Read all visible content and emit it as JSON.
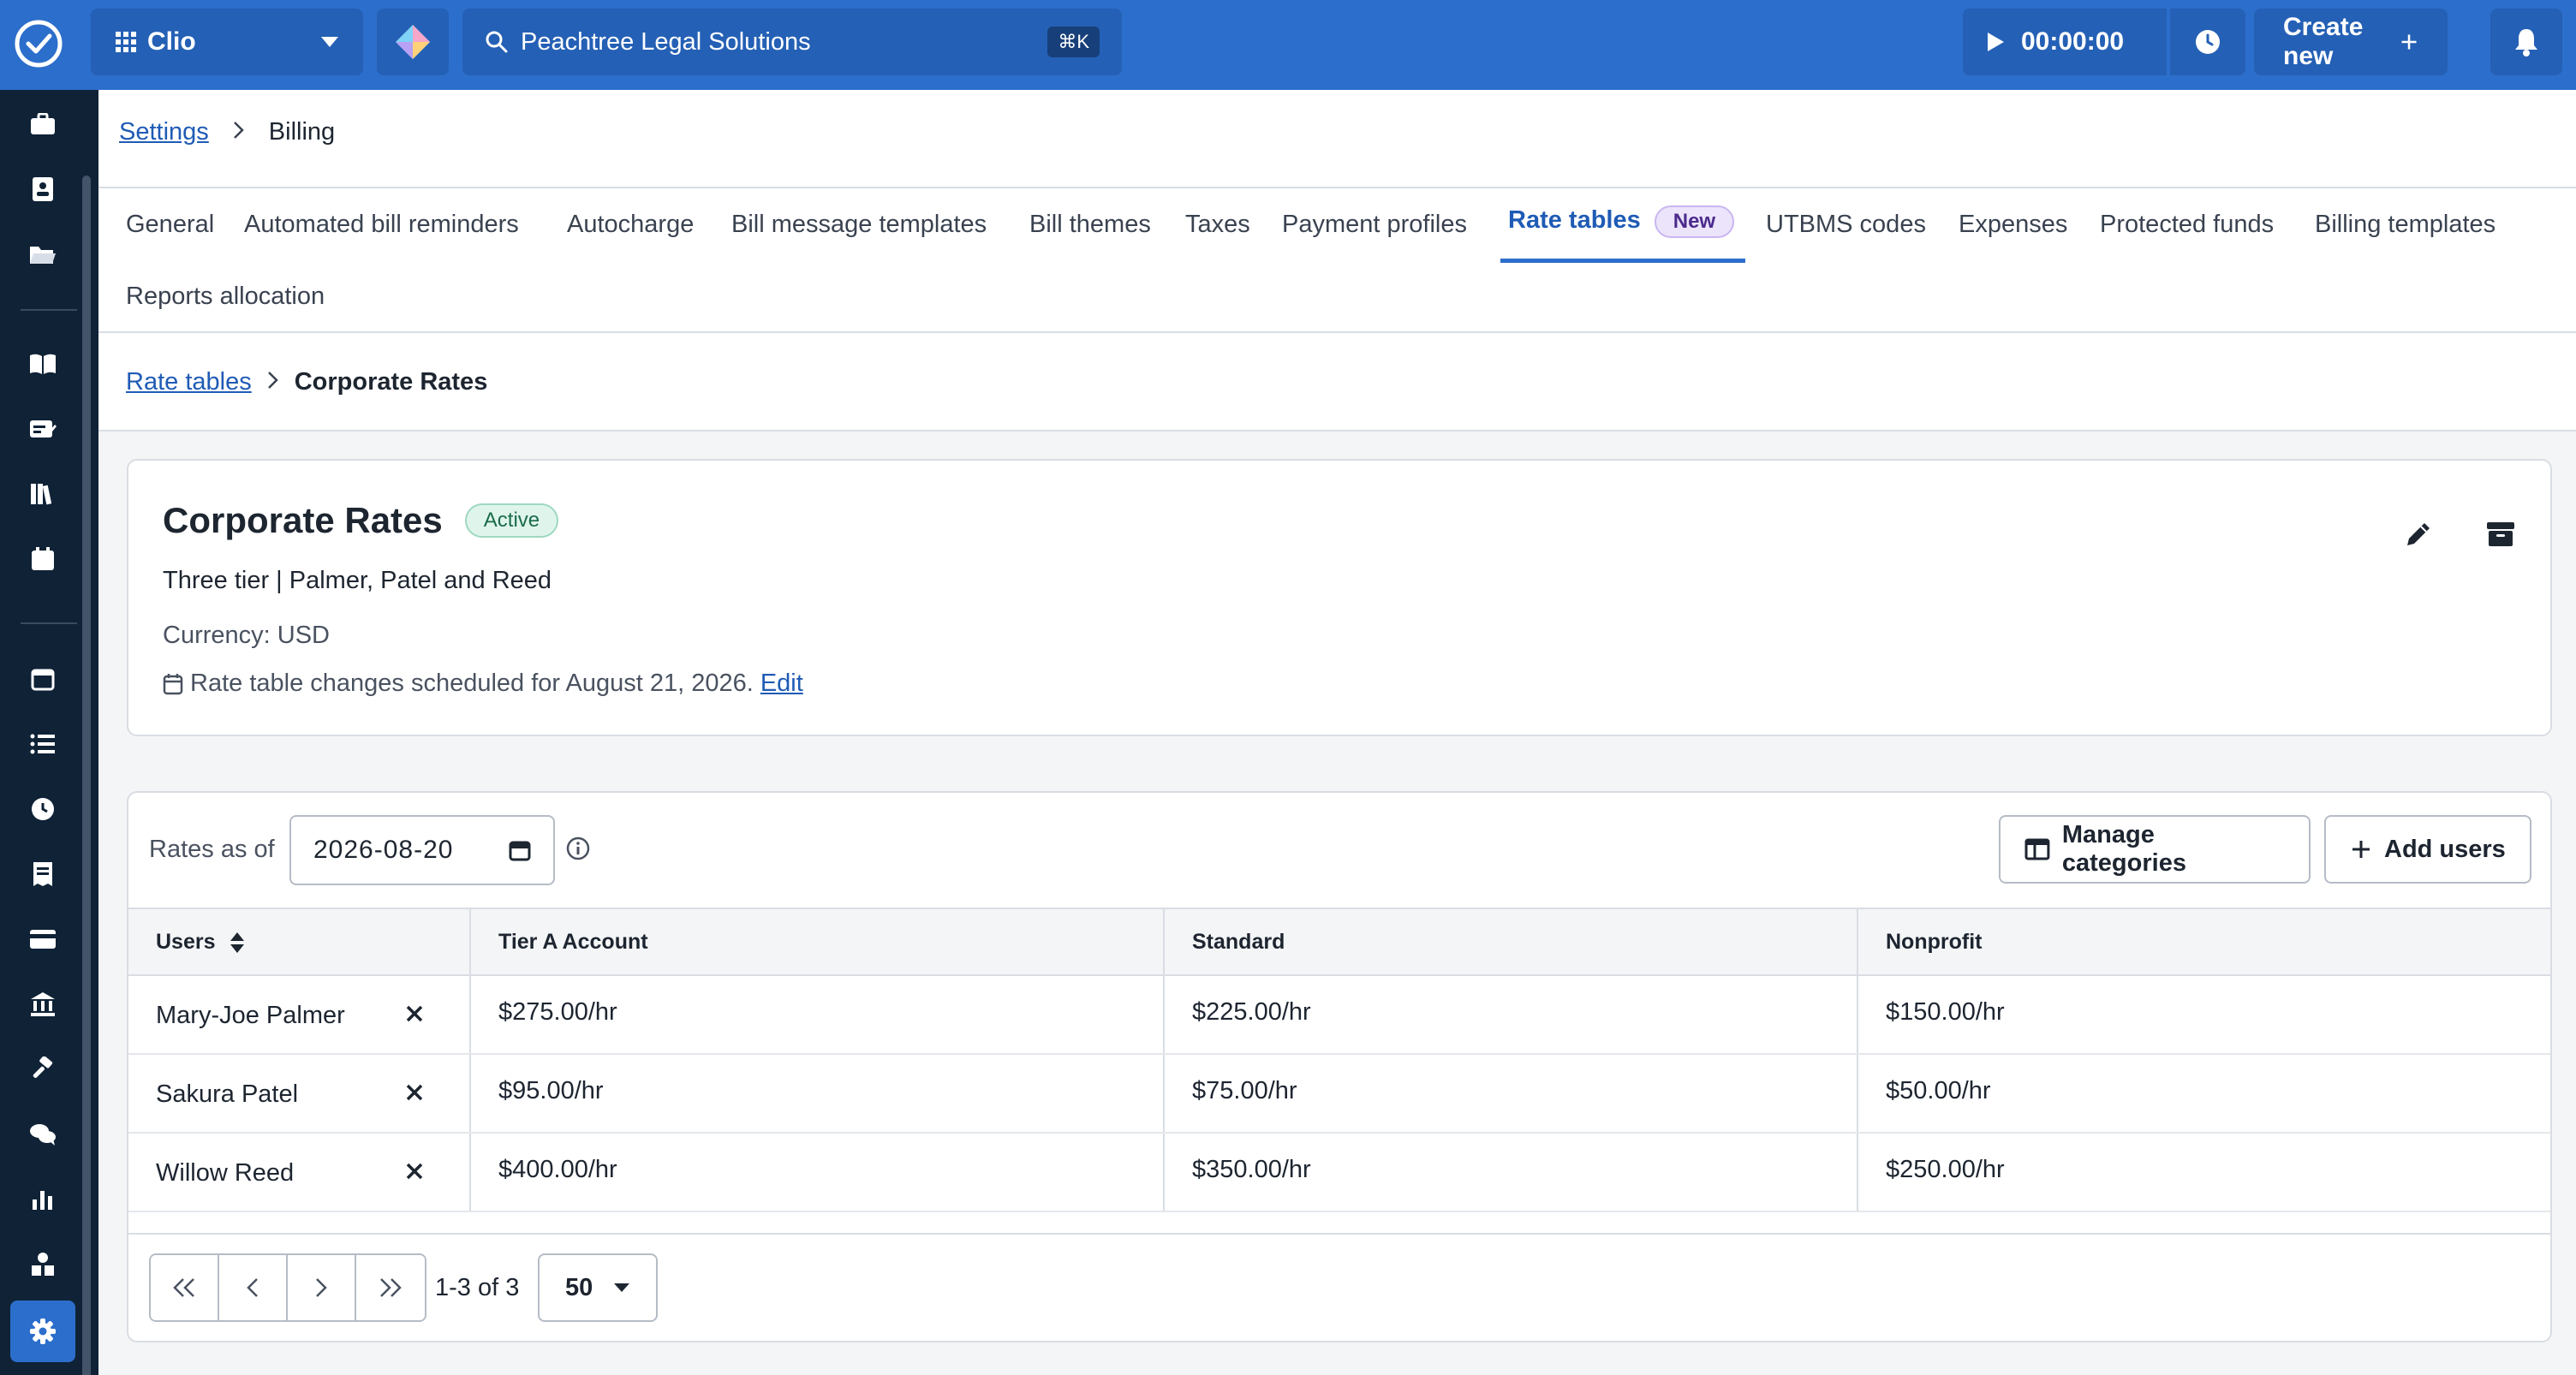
{
  "topbar": {
    "app_name": "Clio",
    "search_text": "Peachtree Legal Solutions",
    "search_shortcut": "⌘K",
    "timer": "00:00:00",
    "create_new_label": "Create new"
  },
  "breadcrumb": {
    "settings": "Settings",
    "billing": "Billing"
  },
  "tabs": [
    {
      "label": "General"
    },
    {
      "label": "Automated bill reminders"
    },
    {
      "label": "Autocharge"
    },
    {
      "label": "Bill message templates"
    },
    {
      "label": "Bill themes"
    },
    {
      "label": "Taxes"
    },
    {
      "label": "Payment profiles"
    },
    {
      "label": "Rate tables",
      "badge": "New",
      "active": true
    },
    {
      "label": "UTBMS codes"
    },
    {
      "label": "Expenses"
    },
    {
      "label": "Protected funds"
    },
    {
      "label": "Billing templates"
    },
    {
      "label": "Reports allocation"
    }
  ],
  "sub_breadcrumb": {
    "parent": "Rate tables",
    "current": "Corporate Rates"
  },
  "rate_table": {
    "title": "Corporate Rates",
    "status": "Active",
    "description": "Three tier | Palmer, Patel and Reed",
    "currency": "Currency: USD",
    "schedule_text": "Rate table changes scheduled for August 21, 2026.",
    "schedule_edit": "Edit"
  },
  "rates": {
    "rates_as_of_label": "Rates as of",
    "date_value": "2026-08-20",
    "manage_categories_label": "Manage categories",
    "add_users_label": "Add users",
    "columns": [
      "Users",
      "Tier A Account",
      "Standard",
      "Nonprofit"
    ],
    "rows": [
      {
        "user": "Mary-Joe Palmer",
        "tier_a": "$275.00/hr",
        "standard": "$225.00/hr",
        "nonprofit": "$150.00/hr"
      },
      {
        "user": "Sakura Patel",
        "tier_a": "$95.00/hr",
        "standard": "$75.00/hr",
        "nonprofit": "$50.00/hr"
      },
      {
        "user": "Willow Reed",
        "tier_a": "$400.00/hr",
        "standard": "$350.00/hr",
        "nonprofit": "$250.00/hr"
      }
    ]
  },
  "pagination": {
    "range_text": "1-3 of 3",
    "page_size": "50"
  },
  "colors": {
    "topbar": "#2c6ecb",
    "sidebar": "#0f2236",
    "link": "#1f5bb5"
  }
}
